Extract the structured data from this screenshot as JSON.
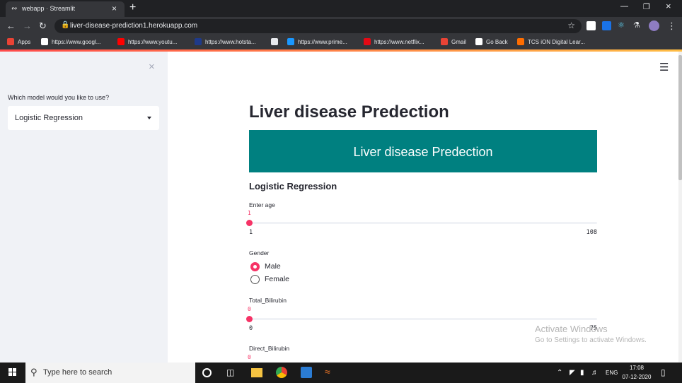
{
  "browser": {
    "tab_title": "webapp · Streamlit",
    "url": "liver-disease-prediction1.herokuapp.com",
    "bookmarks": [
      {
        "label": "Apps",
        "icon": "apps-grid-icon",
        "color": "#ea4335"
      },
      {
        "label": "https://www.googl...",
        "icon": "google-icon",
        "color": "#ffffff"
      },
      {
        "label": "https://www.youtu...",
        "icon": "youtube-icon",
        "color": "#ff0000"
      },
      {
        "label": "https://www.hotsta...",
        "icon": "hotstar-icon",
        "color": "#1f3a8a"
      },
      {
        "label": "",
        "icon": "globe-icon",
        "color": "#e8eaed"
      },
      {
        "label": "https://www.prime...",
        "icon": "prime-video-icon",
        "color": "#1a98ff"
      },
      {
        "label": "https://www.netflix...",
        "icon": "netflix-icon",
        "color": "#e50914"
      },
      {
        "label": "Gmail",
        "icon": "gmail-icon",
        "color": "#ea4335"
      },
      {
        "label": "Go Back",
        "icon": "tcs-icon",
        "color": "#ffffff"
      },
      {
        "label": "TCS iON Digital Lear...",
        "icon": "tcs-ion-icon",
        "color": "#ff6d00"
      }
    ]
  },
  "sidebar": {
    "model_label": "Which model would you like to use?",
    "model_value": "Logistic Regression"
  },
  "main": {
    "title": "Liver disease Predection",
    "banner_text": "Liver disease Predection",
    "banner_color": "#008080",
    "model_heading": "Logistic Regression",
    "age": {
      "label": "Enter age",
      "value": "1",
      "min": "1",
      "max": "108",
      "fraction": 0
    },
    "gender": {
      "label": "Gender",
      "options": [
        "Male",
        "Female"
      ],
      "selected": "Male"
    },
    "total_bilirubin": {
      "label": "Total_Bilirubin",
      "value": "0",
      "min": "0",
      "max": "75",
      "fraction": 0
    },
    "direct_bilirubin": {
      "label": "Direct_Bilirubin",
      "value": "0"
    }
  },
  "watermark": {
    "line1": "Activate Windows",
    "line2": "Go to Settings to activate Windows."
  },
  "taskbar": {
    "search_placeholder": "Type here to search",
    "lang": "ENG",
    "time": "17:08",
    "date": "07-12-2020"
  },
  "colors": {
    "accent": "#f63366",
    "sidebar_bg": "#f0f2f6"
  }
}
